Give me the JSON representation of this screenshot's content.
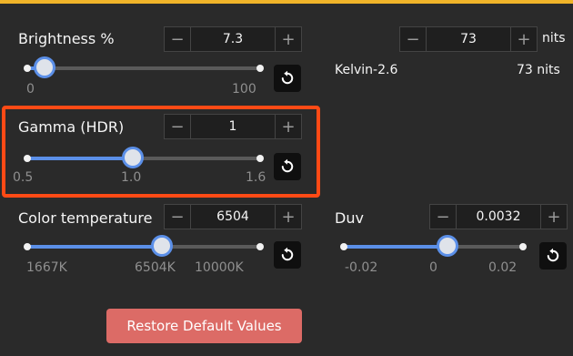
{
  "brightness": {
    "label": "Brightness %",
    "value": "7.3",
    "min_label": "0",
    "max_label": "100",
    "fraction": 0.073
  },
  "nits": {
    "value": "73",
    "unit": "nits",
    "kelvin_label": "Kelvin-2.6",
    "readout": "73 nits"
  },
  "gamma": {
    "label": "Gamma (HDR)",
    "value": "1",
    "ticks": [
      "0.5",
      "1.0",
      "1.6"
    ],
    "fraction": 0.455
  },
  "color_temperature": {
    "label": "Color temperature",
    "value": "6504",
    "ticks": [
      "1667K",
      "6504K",
      "10000K"
    ],
    "fraction": 0.58
  },
  "duv": {
    "label": "Duv",
    "value": "0.0032",
    "ticks": [
      "-0.02",
      "0",
      "0.02"
    ],
    "fraction": 0.58
  },
  "stepper": {
    "minus": "−",
    "plus": "+"
  },
  "restore_label": "Restore Default Values",
  "colors": {
    "accent": "#5b8fe8",
    "highlight": "#ff4a15",
    "restore": "#dc6b66",
    "topbar": "#f0b429"
  }
}
